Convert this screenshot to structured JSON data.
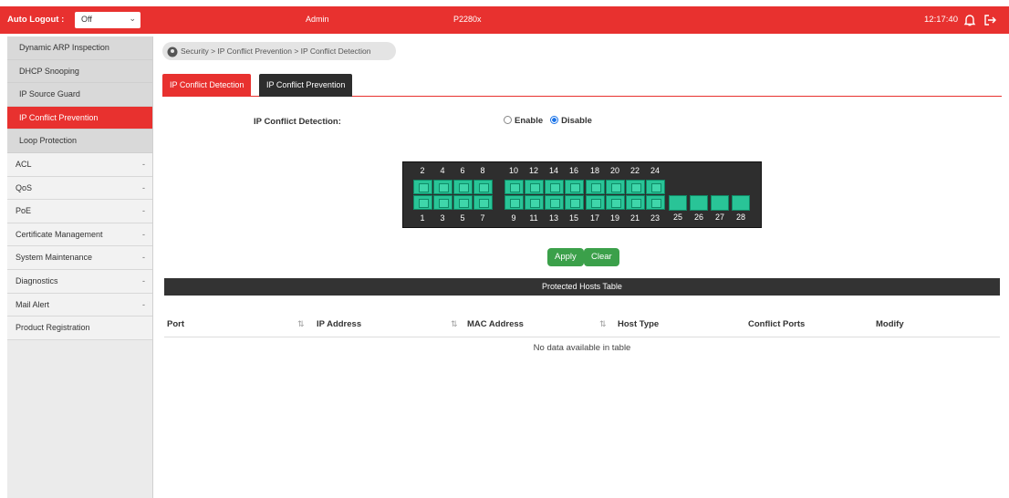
{
  "topbar": {
    "auto_logout_label": "Auto Logout :",
    "auto_logout_value": "Off",
    "user": "Admin",
    "model": "P2280x",
    "time": "12:17:40",
    "bell_icon": "bell-icon",
    "logout_icon": "logout-icon",
    "accent": "#e8312f"
  },
  "sidebar": {
    "sub_items": [
      {
        "label": "Dynamic ARP Inspection",
        "active": false
      },
      {
        "label": "DHCP Snooping",
        "active": false
      },
      {
        "label": "IP Source Guard",
        "active": false
      },
      {
        "label": "IP Conflict Prevention",
        "active": true
      },
      {
        "label": "Loop Protection",
        "active": false
      }
    ],
    "main_items": [
      {
        "label": "ACL",
        "marker": "-"
      },
      {
        "label": "QoS",
        "marker": "-"
      },
      {
        "label": "PoE",
        "marker": "-"
      },
      {
        "label": "Certificate Management",
        "marker": "-"
      },
      {
        "label": "System Maintenance",
        "marker": "-"
      },
      {
        "label": "Diagnostics",
        "marker": "-"
      },
      {
        "label": "Mail Alert",
        "marker": "-"
      },
      {
        "label": "Product Registration",
        "marker": ""
      }
    ]
  },
  "breadcrumb": {
    "text": "Security > IP Conflict Prevention > IP Conflict Detection",
    "icon": "location-pin-icon"
  },
  "tabs": [
    {
      "label": "IP Conflict Detection",
      "active": true,
      "color": "#e8312f"
    },
    {
      "label": "IP Conflict Prevention",
      "active": false,
      "color": "#2d2d2d"
    }
  ],
  "form": {
    "label": "IP Conflict Detection:",
    "enable_label": "Enable",
    "disable_label": "Disable",
    "selected": "Disable"
  },
  "ports": {
    "top_numbers": [
      "2",
      "4",
      "6",
      "8",
      "10",
      "12",
      "14",
      "16",
      "18",
      "20",
      "22",
      "24"
    ],
    "bottom_numbers": [
      "1",
      "3",
      "5",
      "7",
      "9",
      "11",
      "13",
      "15",
      "17",
      "19",
      "21",
      "23"
    ],
    "sfp_numbers": [
      "25",
      "26",
      "27",
      "28"
    ],
    "port_color": "#29c497"
  },
  "buttons": {
    "apply": "Apply",
    "clear": "Clear"
  },
  "table": {
    "title": "Protected Hosts Table",
    "columns": [
      "Port",
      "IP Address",
      "MAC Address",
      "Host Type",
      "Conflict Ports",
      "Modify"
    ],
    "empty_text": "No data available in table",
    "rows": []
  }
}
